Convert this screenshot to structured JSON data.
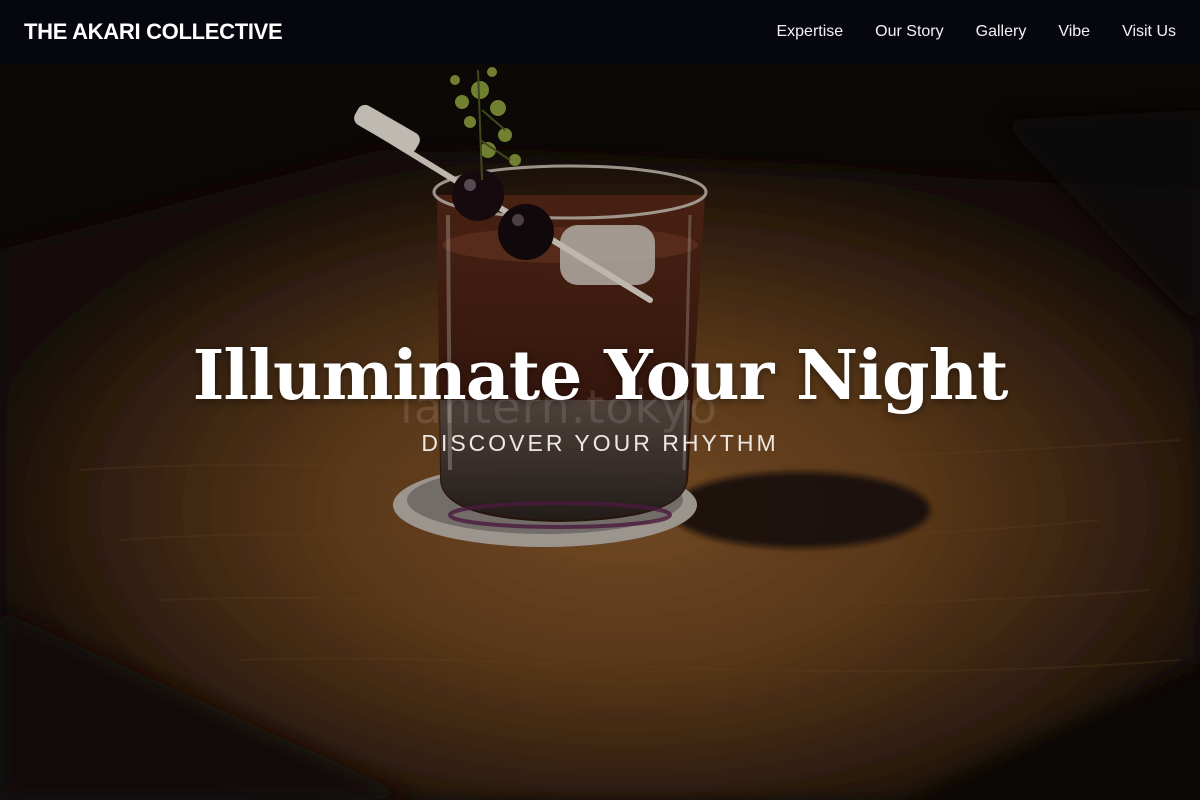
{
  "nav": {
    "brand": "THE AKARI COLLECTIVE",
    "links": [
      {
        "label": "Expertise"
      },
      {
        "label": "Our Story"
      },
      {
        "label": "Gallery"
      },
      {
        "label": "Vibe"
      },
      {
        "label": "Visit Us"
      }
    ]
  },
  "hero": {
    "title": "Illuminate Your Night",
    "subtitle": "DISCOVER YOUR RHYTHM",
    "image_watermark": "lantern.tokyo"
  },
  "colors": {
    "nav_background": "#06060f",
    "nav_text": "#f2f2f2",
    "hero_text": "#ffffff"
  }
}
